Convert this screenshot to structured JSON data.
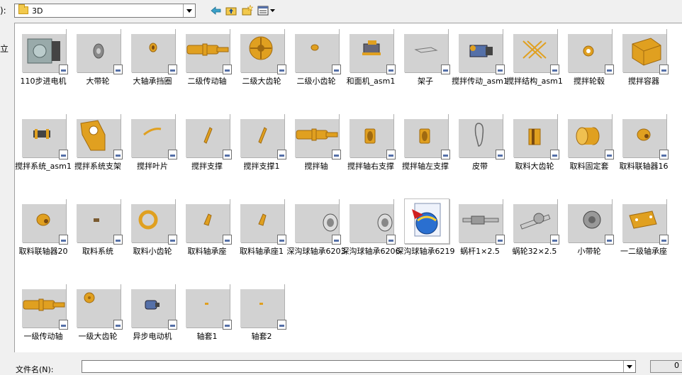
{
  "toolbar": {
    "lookin_label": "):",
    "folder_value": "3D"
  },
  "side_label": "立",
  "items": [
    {
      "label": "110步进电机",
      "icon": "stepper-motor"
    },
    {
      "label": "大带轮",
      "icon": "pulley"
    },
    {
      "label": "大轴承挡圈",
      "icon": "ring"
    },
    {
      "label": "二级传动轴",
      "icon": "shaft"
    },
    {
      "label": "二级大齿轮",
      "icon": "gear"
    },
    {
      "label": "二级小齿轮",
      "icon": "small-gear"
    },
    {
      "label": "和面机_asm1",
      "icon": "assembly"
    },
    {
      "label": "架子",
      "icon": "frame"
    },
    {
      "label": "搅拌传动_asm1",
      "icon": "drive-assembly"
    },
    {
      "label": "搅拌结构_asm1",
      "icon": "structure"
    },
    {
      "label": "搅拌轮毂",
      "icon": "hub"
    },
    {
      "label": "搅拌容器",
      "icon": "container"
    },
    {
      "label": "搅拌系统_asm1",
      "icon": "system-assembly"
    },
    {
      "label": "搅拌系统支架",
      "icon": "bracket"
    },
    {
      "label": "搅拌叶片",
      "icon": "blade"
    },
    {
      "label": "搅拌支撑",
      "icon": "support"
    },
    {
      "label": "搅拌支撑1",
      "icon": "support"
    },
    {
      "label": "搅拌轴",
      "icon": "shaft"
    },
    {
      "label": "搅拌轴右支撑",
      "icon": "bearing-support"
    },
    {
      "label": "搅拌轴左支撑",
      "icon": "bearing-support"
    },
    {
      "label": "皮带",
      "icon": "belt"
    },
    {
      "label": "取料大齿轮",
      "icon": "gear-side"
    },
    {
      "label": "取料固定套",
      "icon": "sleeve"
    },
    {
      "label": "取料联轴器16",
      "icon": "coupling"
    },
    {
      "label": "取料联轴器20",
      "icon": "coupling"
    },
    {
      "label": "取料系统",
      "icon": "tiny-part"
    },
    {
      "label": "取料小齿轮",
      "icon": "ring-gear"
    },
    {
      "label": "取料轴承座",
      "icon": "bearing-seat"
    },
    {
      "label": "取料轴承座1",
      "icon": "bearing-seat"
    },
    {
      "label": "深沟球轴承6203",
      "icon": "bearing"
    },
    {
      "label": "深沟球轴承6206",
      "icon": "bearing"
    },
    {
      "label": "深沟球轴承6219",
      "icon": "app-file"
    },
    {
      "label": "蜗杆1×2.5",
      "icon": "worm"
    },
    {
      "label": "蜗轮32×2.5",
      "icon": "worm-wheel"
    },
    {
      "label": "小带轮",
      "icon": "pulley-small"
    },
    {
      "label": "一二级轴承座",
      "icon": "plate"
    },
    {
      "label": "一级传动轴",
      "icon": "shaft"
    },
    {
      "label": "一级大齿轮",
      "icon": "gear-front"
    },
    {
      "label": "异步电动机",
      "icon": "motor"
    },
    {
      "label": "轴套1",
      "icon": "dot"
    },
    {
      "label": "轴套2",
      "icon": "dot"
    }
  ],
  "footer": {
    "filename_label": "文件名(N):",
    "filename_value": "",
    "open_button": "0"
  },
  "colors": {
    "part_orange": "#e0a020",
    "thumb_bg": "#d2d2d2"
  }
}
